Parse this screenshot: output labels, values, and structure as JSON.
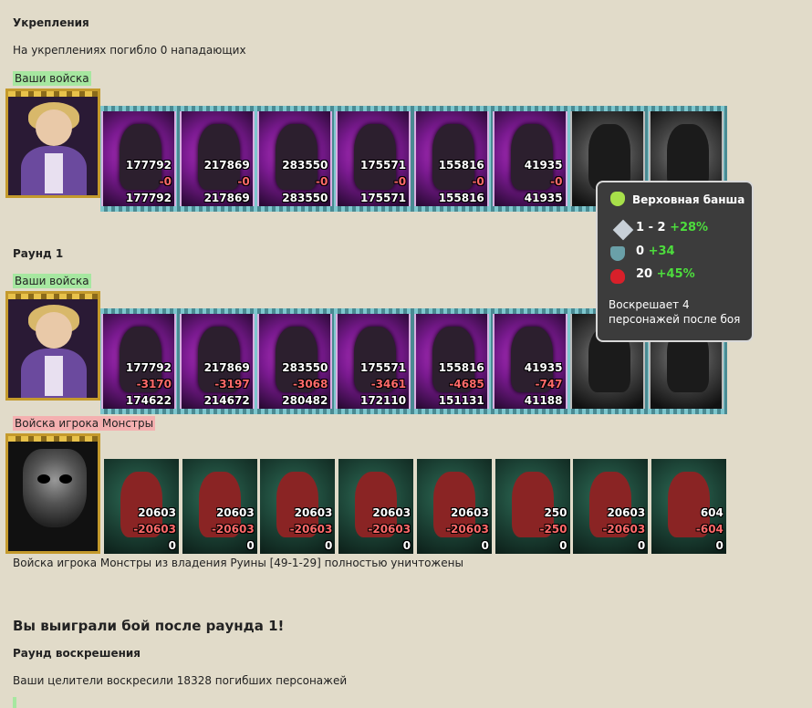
{
  "fort": {
    "title": "Укрепления",
    "text": "На укреплениях погибло 0 нападающих"
  },
  "labels": {
    "your_troops": "Ваши войска",
    "enemy_troops": "Войска игрока Монстры"
  },
  "round1": {
    "title": "Раунд 1"
  },
  "fort_units": [
    {
      "a": "177792",
      "b": "-0",
      "c": "177792",
      "style": "purple"
    },
    {
      "a": "217869",
      "b": "-0",
      "c": "217869",
      "style": "purple"
    },
    {
      "a": "283550",
      "b": "-0",
      "c": "283550",
      "style": "purple"
    },
    {
      "a": "175571",
      "b": "-0",
      "c": "175571",
      "style": "purple"
    },
    {
      "a": "155816",
      "b": "-0",
      "c": "155816",
      "style": "purple"
    },
    {
      "a": "41935",
      "b": "-0",
      "c": "41935",
      "style": "purple"
    },
    {
      "a": "",
      "b": "",
      "c": "",
      "style": "grey"
    },
    {
      "a": "",
      "b": "",
      "c": "",
      "style": "grey"
    }
  ],
  "round_units": [
    {
      "a": "177792",
      "b": "-3170",
      "c": "174622",
      "style": "purple"
    },
    {
      "a": "217869",
      "b": "-3197",
      "c": "214672",
      "style": "purple"
    },
    {
      "a": "283550",
      "b": "-3068",
      "c": "280482",
      "style": "purple"
    },
    {
      "a": "175571",
      "b": "-3461",
      "c": "172110",
      "style": "purple"
    },
    {
      "a": "155816",
      "b": "-4685",
      "c": "151131",
      "style": "purple"
    },
    {
      "a": "41935",
      "b": "-747",
      "c": "41188",
      "style": "purple"
    },
    {
      "a": "",
      "b": "",
      "c": "",
      "style": "grey"
    },
    {
      "a": "",
      "b": "",
      "c": "",
      "style": "grey"
    }
  ],
  "enemy_units": [
    {
      "a": "20603",
      "b": "-20603",
      "c": "0"
    },
    {
      "a": "20603",
      "b": "-20603",
      "c": "0"
    },
    {
      "a": "20603",
      "b": "-20603",
      "c": "0"
    },
    {
      "a": "20603",
      "b": "-20603",
      "c": "0"
    },
    {
      "a": "20603",
      "b": "-20603",
      "c": "0"
    },
    {
      "a": "250",
      "b": "-250",
      "c": "0"
    },
    {
      "a": "20603",
      "b": "-20603",
      "c": "0"
    },
    {
      "a": "604",
      "b": "-604",
      "c": "0"
    }
  ],
  "enemy_destroyed": "Войска игрока Монстры из владения Руины [49-1-29] полностью уничтожены",
  "victory": "Вы выиграли бой после раунда 1!",
  "resurrection": {
    "title": "Раунд воскрешения",
    "text": "Ваши целители воскресили 18328 погибших персонажей"
  },
  "tooltip": {
    "title": "Верховная банша",
    "attack": "1 - 2",
    "attack_bonus": "+28%",
    "defense": "0",
    "defense_bonus": "+34",
    "hp": "20",
    "hp_bonus": "+45%",
    "desc": "Воскрешает 4 персонажей после боя",
    "icons": [
      "potion-icon",
      "sword-icon",
      "shield-icon",
      "heart-icon"
    ]
  },
  "colors": {
    "background": "#e1dbc9",
    "ally_tag": "#a6e7a0",
    "enemy_tag": "#f4b0b0",
    "loss": "#ff6a6a",
    "bonus": "#4ddd3d"
  }
}
